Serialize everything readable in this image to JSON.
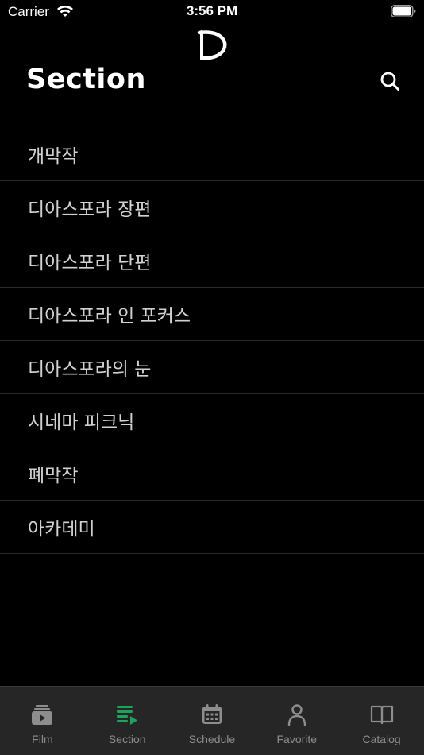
{
  "status_bar": {
    "carrier": "Carrier",
    "time": "3:56 PM"
  },
  "header": {
    "title": "Section",
    "logo_icon": "d-logo-icon",
    "search_icon": "search-icon"
  },
  "sections": [
    {
      "label": "개막작"
    },
    {
      "label": "디아스포라 장편"
    },
    {
      "label": "디아스포라 단편"
    },
    {
      "label": "디아스포라 인 포커스"
    },
    {
      "label": "디아스포라의 눈"
    },
    {
      "label": "시네마 피크닉"
    },
    {
      "label": "폐막작"
    },
    {
      "label": "아카데미"
    }
  ],
  "tabs": [
    {
      "label": "Film",
      "icon": "film-icon",
      "active": false
    },
    {
      "label": "Section",
      "icon": "section-list-icon",
      "active": true
    },
    {
      "label": "Schedule",
      "icon": "calendar-icon",
      "active": false
    },
    {
      "label": "Favorite",
      "icon": "person-icon",
      "active": false
    },
    {
      "label": "Catalog",
      "icon": "book-icon",
      "active": false
    }
  ],
  "colors": {
    "background": "#000000",
    "tab_bar_background": "#262626",
    "accent_active": "#1fa35c",
    "inactive_icon": "#8d8d8d",
    "list_text": "#d2d2d2",
    "divider": "#2a2a2a"
  }
}
